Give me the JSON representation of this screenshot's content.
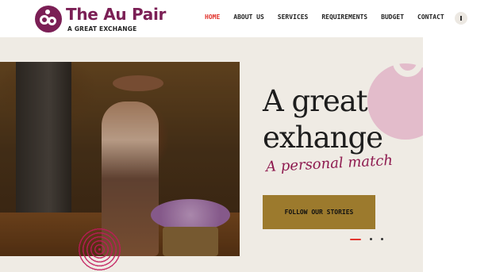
{
  "brand": {
    "title": "The Au Pair",
    "tagline": "A GREAT EXCHANGE",
    "color": "#7b1f55"
  },
  "nav": {
    "items": [
      {
        "label": "HOME",
        "active": true
      },
      {
        "label": "ABOUT US",
        "active": false
      },
      {
        "label": "SERVICES",
        "active": false
      },
      {
        "label": "REQUIREMENTS",
        "active": false
      },
      {
        "label": "BUDGET",
        "active": false
      },
      {
        "label": "CONTACT",
        "active": false
      }
    ],
    "active_color": "#e2352e",
    "toggle_icon": "info-toggle-icon"
  },
  "hero": {
    "title_line1": "A great",
    "title_line2": "exhange",
    "script_text": "A personal match",
    "cta_label": "FOLLOW OUR STORIES",
    "cta_color": "#9c7a2d",
    "background": "#efebe4",
    "slides": {
      "count": 3,
      "active": 1
    }
  }
}
